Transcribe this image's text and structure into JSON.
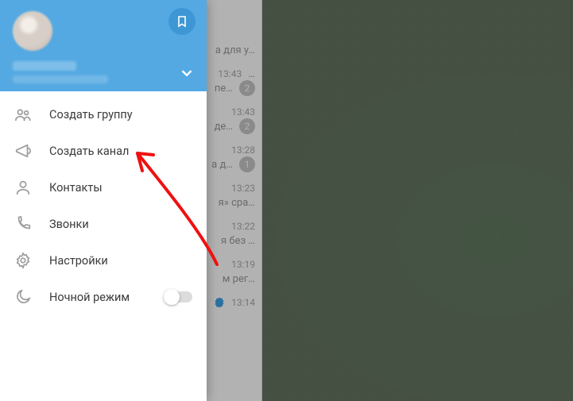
{
  "drawer": {
    "bookmark_aria": "Saved Messages",
    "expand_aria": "Expand accounts",
    "items": [
      {
        "icon": "group-icon",
        "label": "Создать группу"
      },
      {
        "icon": "channel-icon",
        "label": "Создать канал"
      },
      {
        "icon": "contacts-icon",
        "label": "Контакты"
      },
      {
        "icon": "calls-icon",
        "label": "Звонки"
      },
      {
        "icon": "settings-icon",
        "label": "Настройки"
      },
      {
        "icon": "moon-icon",
        "label": "Ночной режим",
        "switch": true
      }
    ]
  },
  "chatlist": [
    {
      "snippet": "а для у…",
      "time": "",
      "badge": ""
    },
    {
      "snippet": "…",
      "time": "13:43",
      "badge": ""
    },
    {
      "snippet": "пе…",
      "time": "",
      "badge": "2"
    },
    {
      "snippet": "",
      "time": "13:43",
      "badge": ""
    },
    {
      "snippet": "де…",
      "time": "",
      "badge": "2"
    },
    {
      "snippet": "",
      "time": "13:28",
      "badge": ""
    },
    {
      "snippet": "а д…",
      "time": "",
      "badge": "1"
    },
    {
      "snippet": "",
      "time": "13:23",
      "badge": ""
    },
    {
      "snippet": "я» сра…",
      "time": "",
      "badge": ""
    },
    {
      "snippet": "",
      "time": "13:22",
      "badge": ""
    },
    {
      "snippet": "я без …",
      "time": "",
      "badge": ""
    },
    {
      "snippet": "",
      "time": "13:19",
      "badge": ""
    },
    {
      "snippet": "м рег…",
      "time": "",
      "badge": ""
    },
    {
      "snippet": "",
      "time": "13:14",
      "badge": "",
      "verified": true
    }
  ]
}
